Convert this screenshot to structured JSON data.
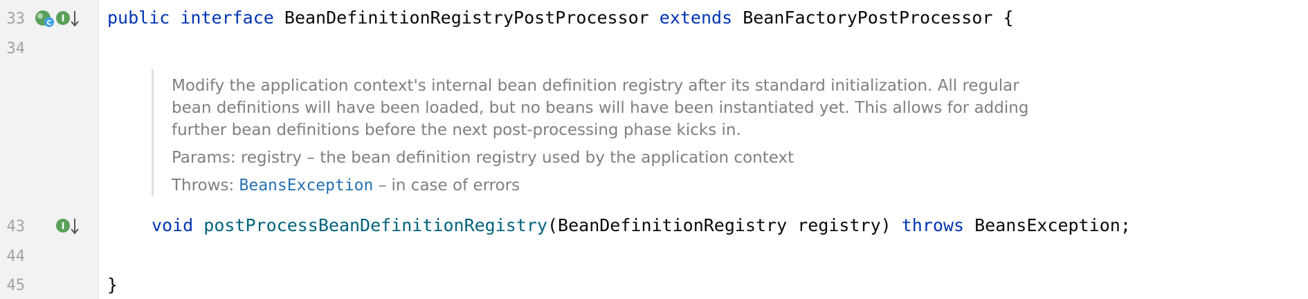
{
  "editor": {
    "line_numbers": [
      "33",
      "34",
      "43",
      "44",
      "45"
    ],
    "line33": {
      "kw_public": "public",
      "kw_interface": "interface",
      "name": "BeanDefinitionRegistryPostProcessor",
      "kw_extends": "extends",
      "parent": "BeanFactoryPostProcessor",
      "brace": "{"
    },
    "doc": {
      "description": "Modify the application context's internal bean definition registry after its standard initialization. All regular bean definitions will have been loaded, but no beans will have been instantiated yet. This allows for adding further bean definitions before the next post-processing phase kicks in.",
      "params_label": "Params:",
      "params_text": "registry – the bean definition registry used by the application context",
      "throws_label": "Throws:",
      "throws_link": "BeansException",
      "throws_text": "– in case of errors"
    },
    "line43": {
      "kw_void": "void",
      "method": "postProcessBeanDefinitionRegistry",
      "params": "(BeanDefinitionRegistry registry) ",
      "kw_throws": "throws",
      "exception": " BeansException;"
    },
    "line45": {
      "brace": "}"
    }
  },
  "colors": {
    "keyword": "#0033b3",
    "method": "#00627a",
    "doc_text": "#7f7f7f",
    "link": "#2470b3",
    "gutter_bg": "#f2f2f2"
  },
  "icons": {
    "line33": [
      "implementations-icon",
      "implemented-interface-icon",
      "navigate-down-arrow-icon"
    ],
    "line43": [
      "implemented-method-icon",
      "navigate-down-arrow-icon"
    ]
  }
}
